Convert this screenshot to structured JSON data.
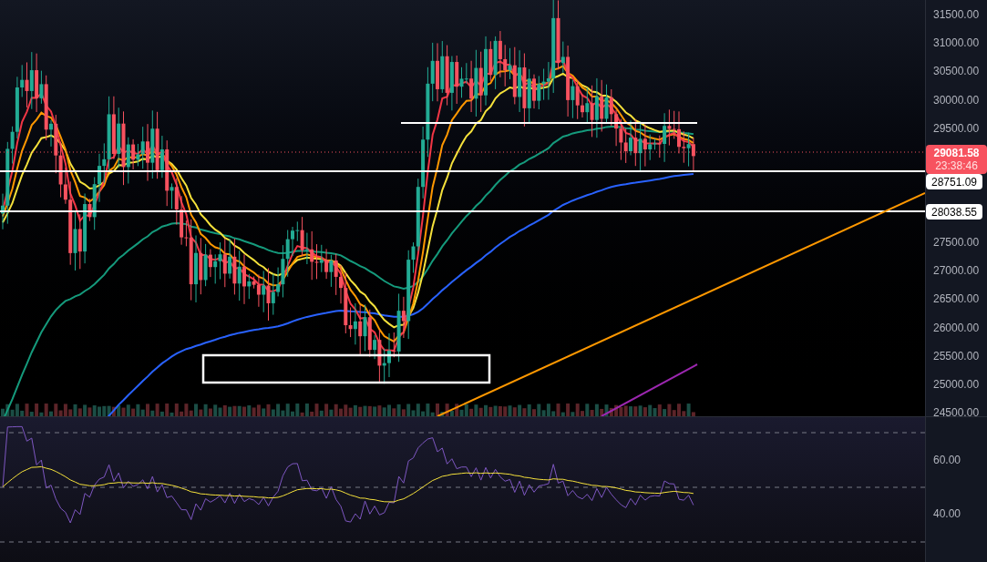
{
  "price_axis": {
    "upper_ticks": [
      "31500.00",
      "31000.00",
      "30500.00",
      "30000.00",
      "29500.00"
    ],
    "lower_ticks": [
      "27500.00",
      "27000.00",
      "26500.00",
      "26000.00",
      "25500.00",
      "25000.00",
      "24500.00"
    ]
  },
  "price_badge": {
    "price": "29081.58",
    "countdown": "23:38:46"
  },
  "level_labels": [
    "28751.09",
    "28038.55"
  ],
  "rsi_axis": {
    "ticks": [
      "60.00",
      "40.00"
    ]
  }
}
